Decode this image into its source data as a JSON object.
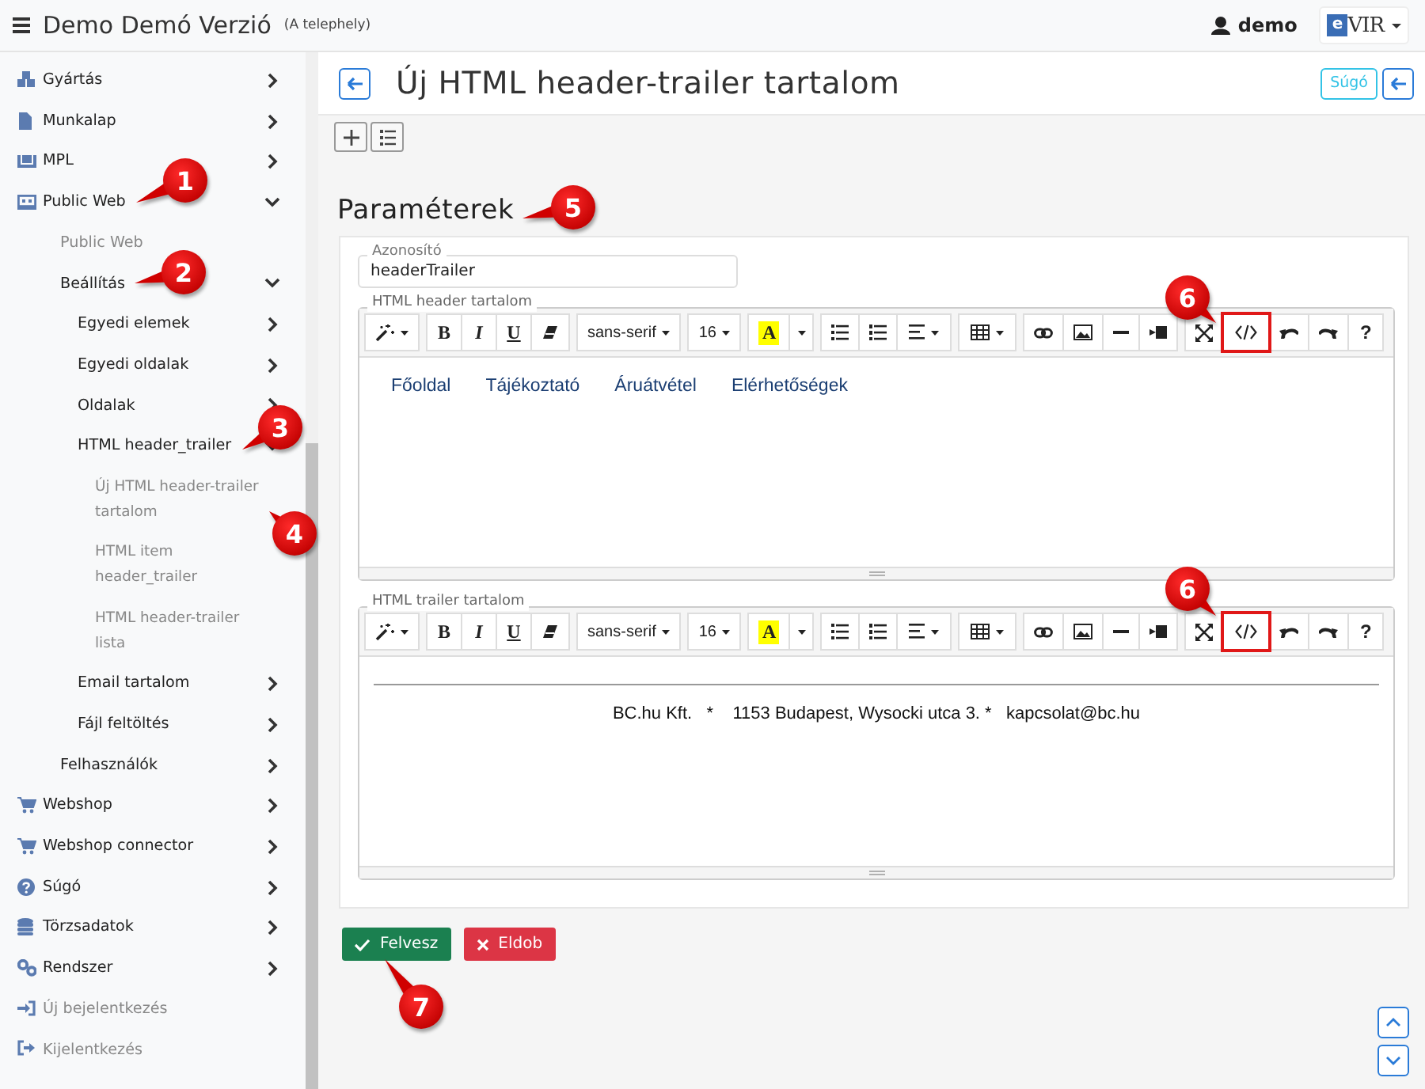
{
  "topbar": {
    "title": "Demo Demó Verzió",
    "subtitle": "(A telephely)",
    "user": "demo",
    "logo": {
      "mark": "e",
      "text": "VIR"
    }
  },
  "sidebar": {
    "items": [
      {
        "label": "Gyártás",
        "kind": "group",
        "expanded": false
      },
      {
        "label": "Munkalap",
        "kind": "group",
        "expanded": false
      },
      {
        "label": "MPL",
        "kind": "group",
        "expanded": false
      },
      {
        "label": "Public Web",
        "kind": "group",
        "expanded": true,
        "children": [
          {
            "label": "Public Web",
            "kind": "page"
          },
          {
            "label": "Beállítás",
            "kind": "group",
            "expanded": true,
            "children": [
              {
                "label": "Egyedi elemek",
                "kind": "group",
                "expanded": false
              },
              {
                "label": "Egyedi oldalak",
                "kind": "group",
                "expanded": false
              },
              {
                "label": "Oldalak",
                "kind": "group",
                "expanded": false
              },
              {
                "label": "HTML header_trailer",
                "kind": "group",
                "expanded": true,
                "children": [
                  {
                    "label": "Új HTML header-trailer tartalom",
                    "kind": "page"
                  },
                  {
                    "label": "HTML item header_trailer",
                    "kind": "page"
                  },
                  {
                    "label": "HTML header-trailer lista",
                    "kind": "page"
                  }
                ]
              },
              {
                "label": "Email tartalom",
                "kind": "group",
                "expanded": false
              },
              {
                "label": "Fájl feltöltés",
                "kind": "group",
                "expanded": false
              }
            ]
          },
          {
            "label": "Felhasználók",
            "kind": "group",
            "expanded": false
          }
        ]
      },
      {
        "label": "Webshop",
        "kind": "group",
        "expanded": false
      },
      {
        "label": "Webshop connector",
        "kind": "group",
        "expanded": false
      },
      {
        "label": "Súgó",
        "kind": "group",
        "expanded": false
      },
      {
        "label": "Törzsadatok",
        "kind": "group",
        "expanded": false
      },
      {
        "label": "Rendszer",
        "kind": "group",
        "expanded": false
      },
      {
        "label": "Új bejelentkezés",
        "kind": "page"
      },
      {
        "label": "Kijelentkezés",
        "kind": "page"
      }
    ]
  },
  "page": {
    "title": "Új HTML header-trailer tartalom",
    "help_button": "Súgó"
  },
  "heading": "Paraméterek",
  "form": {
    "id_field": {
      "label": "Azonosító",
      "value": "headerTrailer"
    },
    "editors": [
      {
        "label": "HTML header tartalom",
        "toolbar": [
          {
            "buttons": [
              {
                "kind": "wand",
                "highlighted": false
              }
            ]
          },
          {
            "buttons": [
              {
                "kind": "bold",
                "label": "B",
                "highlighted": false
              },
              {
                "kind": "italic",
                "label": "I",
                "highlighted": false
              },
              {
                "kind": "underline",
                "label": "U",
                "highlighted": false
              },
              {
                "kind": "eraser",
                "highlighted": false
              }
            ]
          },
          {
            "buttons": [
              {
                "kind": "font",
                "label": "sans-serif",
                "highlighted": false
              }
            ]
          },
          {
            "buttons": [
              {
                "kind": "size",
                "label": "16",
                "highlighted": false
              }
            ]
          },
          {
            "buttons": [
              {
                "kind": "color",
                "label": "A",
                "highlighted": false
              },
              {
                "kind": "caret",
                "highlighted": false
              }
            ]
          },
          {
            "buttons": [
              {
                "kind": "ul",
                "highlighted": false
              },
              {
                "kind": "ol",
                "highlighted": false
              },
              {
                "kind": "align",
                "highlighted": false
              }
            ]
          },
          {
            "buttons": [
              {
                "kind": "table",
                "highlighted": false
              }
            ]
          },
          {
            "buttons": [
              {
                "kind": "link",
                "highlighted": false
              },
              {
                "kind": "picture",
                "highlighted": false
              },
              {
                "kind": "rule",
                "highlighted": false
              },
              {
                "kind": "video",
                "highlighted": false
              }
            ]
          },
          {
            "buttons": [
              {
                "kind": "fullscreen",
                "highlighted": false
              },
              {
                "kind": "code",
                "highlighted": true
              },
              {
                "kind": "undo",
                "highlighted": false
              },
              {
                "kind": "redo",
                "highlighted": false
              },
              {
                "kind": "help",
                "label": "?",
                "highlighted": false
              }
            ]
          }
        ],
        "content": {
          "kind": "nav",
          "links": [
            "Főoldal",
            "Tájékoztató",
            "Áruátvétel",
            "Elérhetőségek"
          ]
        }
      },
      {
        "label": "HTML trailer tartalom",
        "toolbar": [
          {
            "buttons": [
              {
                "kind": "wand",
                "highlighted": false
              }
            ]
          },
          {
            "buttons": [
              {
                "kind": "bold",
                "label": "B",
                "highlighted": false
              },
              {
                "kind": "italic",
                "label": "I",
                "highlighted": false
              },
              {
                "kind": "underline",
                "label": "U",
                "highlighted": false
              },
              {
                "kind": "eraser",
                "highlighted": false
              }
            ]
          },
          {
            "buttons": [
              {
                "kind": "font",
                "label": "sans-serif",
                "highlighted": false
              }
            ]
          },
          {
            "buttons": [
              {
                "kind": "size",
                "label": "16",
                "highlighted": false
              }
            ]
          },
          {
            "buttons": [
              {
                "kind": "color",
                "label": "A",
                "highlighted": false
              },
              {
                "kind": "caret",
                "highlighted": false
              }
            ]
          },
          {
            "buttons": [
              {
                "kind": "ul",
                "highlighted": false
              },
              {
                "kind": "ol",
                "highlighted": false
              },
              {
                "kind": "align",
                "highlighted": false
              }
            ]
          },
          {
            "buttons": [
              {
                "kind": "table",
                "highlighted": false
              }
            ]
          },
          {
            "buttons": [
              {
                "kind": "link",
                "highlighted": false
              },
              {
                "kind": "picture",
                "highlighted": false
              },
              {
                "kind": "rule",
                "highlighted": false
              },
              {
                "kind": "video",
                "highlighted": false
              }
            ]
          },
          {
            "buttons": [
              {
                "kind": "fullscreen",
                "highlighted": false
              },
              {
                "kind": "code",
                "highlighted": true
              },
              {
                "kind": "undo",
                "highlighted": false
              },
              {
                "kind": "redo",
                "highlighted": false
              },
              {
                "kind": "help",
                "label": "?",
                "highlighted": false
              }
            ]
          }
        ],
        "content": {
          "kind": "footer",
          "text": "BC.hu Kft.   *    1153 Budapest, Wysocki utca 3. *   kapcsolat@bc.hu"
        }
      }
    ]
  },
  "actions": [
    {
      "label": "Felvesz",
      "kind": "save"
    },
    {
      "label": "Eldob",
      "kind": "discard"
    }
  ],
  "annotations": [
    {
      "label": "1"
    },
    {
      "label": "2"
    },
    {
      "label": "3"
    },
    {
      "label": "4"
    },
    {
      "label": "5"
    },
    {
      "label": "6"
    },
    {
      "label": "6"
    },
    {
      "label": "7"
    }
  ]
}
